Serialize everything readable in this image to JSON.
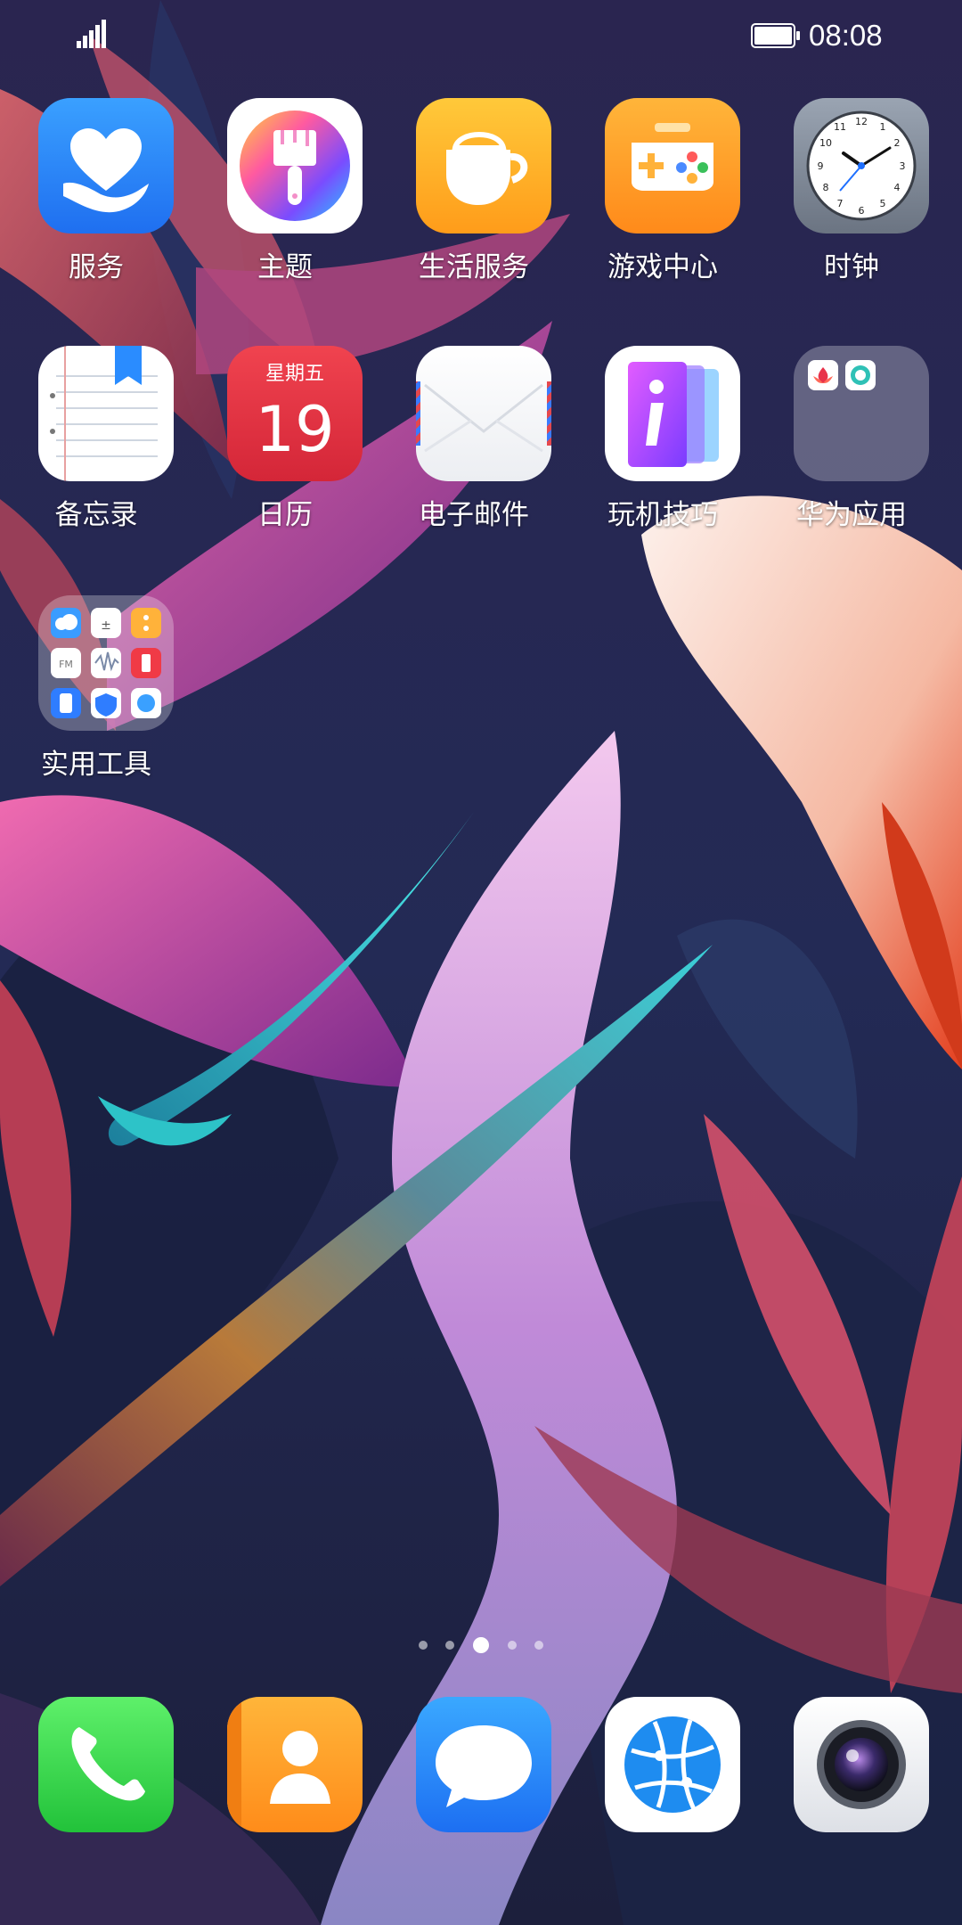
{
  "status_bar": {
    "time": "08:08",
    "signal_icon": "signal-bars-icon",
    "battery_icon": "battery-full-icon"
  },
  "apps": [
    {
      "label": "服务",
      "icon": "heart-hand-icon"
    },
    {
      "label": "主题",
      "icon": "paintbrush-icon"
    },
    {
      "label": "生活服务",
      "icon": "coffee-cup-icon"
    },
    {
      "label": "游戏中心",
      "icon": "gamepad-icon"
    },
    {
      "label": "时钟",
      "icon": "analog-clock-icon"
    },
    {
      "label": "备忘录",
      "icon": "notepad-icon"
    },
    {
      "label": "日历",
      "icon": "calendar-icon"
    },
    {
      "label": "电子邮件",
      "icon": "envelope-icon"
    },
    {
      "label": "玩机技巧",
      "icon": "tips-icon"
    },
    {
      "label": "华为应用",
      "icon": "folder-icon"
    },
    {
      "label": "实用工具",
      "icon": "folder-icon"
    }
  ],
  "calendar": {
    "weekday": "星期五",
    "day": "19"
  },
  "clock_face_numbers": [
    "12",
    "1",
    "2",
    "3",
    "4",
    "5",
    "6",
    "7",
    "8",
    "9",
    "10",
    "11"
  ],
  "page_indicator": {
    "pages": 5,
    "current": 3
  },
  "dock": [
    {
      "name": "phone",
      "icon": "phone-icon"
    },
    {
      "name": "contacts",
      "icon": "contacts-icon"
    },
    {
      "name": "messages",
      "icon": "message-bubble-icon"
    },
    {
      "name": "browser",
      "icon": "globe-icon"
    },
    {
      "name": "camera",
      "icon": "camera-icon"
    }
  ],
  "colors": {
    "wallpaper_base": "#1e2148",
    "label_text": "#ffffff"
  }
}
